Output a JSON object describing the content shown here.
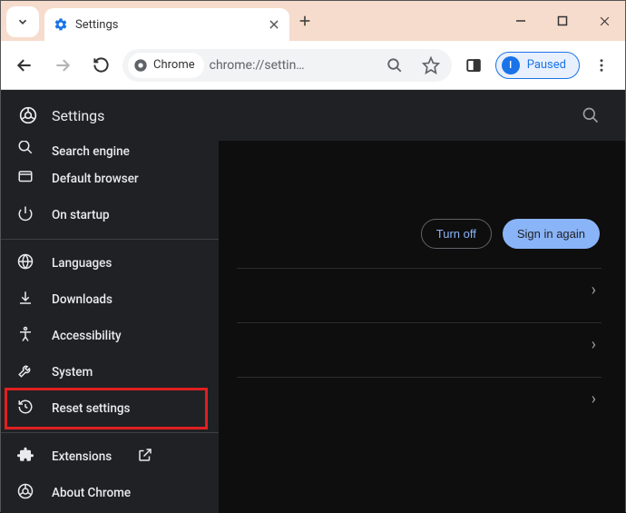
{
  "browser": {
    "tab_title": "Settings",
    "url_display": "chrome://settin…",
    "origin_chip": "Chrome",
    "profile_state": "Paused",
    "profile_initial": "I"
  },
  "header": {
    "title": "Settings"
  },
  "sidebar": {
    "items": [
      {
        "icon": "search",
        "label": "Search engine",
        "cutoff": true
      },
      {
        "icon": "browser",
        "label": "Default browser"
      },
      {
        "icon": "power",
        "label": "On startup"
      },
      {
        "sep": true
      },
      {
        "icon": "globe",
        "label": "Languages"
      },
      {
        "icon": "download",
        "label": "Downloads"
      },
      {
        "icon": "accessibility",
        "label": "Accessibility"
      },
      {
        "icon": "wrench",
        "label": "System"
      },
      {
        "icon": "restore",
        "label": "Reset settings",
        "highlighted": true
      },
      {
        "sep": true
      },
      {
        "icon": "extension",
        "label": "Extensions",
        "external": true
      },
      {
        "icon": "chrome",
        "label": "About Chrome"
      }
    ]
  },
  "main": {
    "turn_off": "Turn off",
    "sign_in_again": "Sign in again"
  }
}
